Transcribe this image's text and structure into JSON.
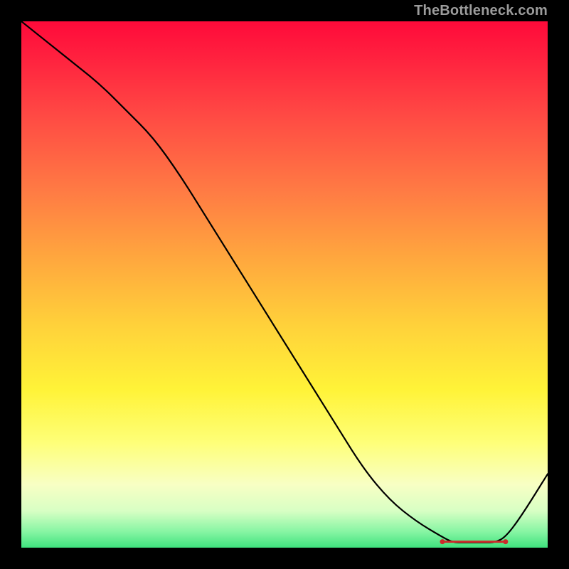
{
  "watermark": "TheBottleneck.com",
  "flat_marker_label": "",
  "chart_data": {
    "type": "line",
    "title": "",
    "xlabel": "",
    "ylabel": "",
    "xlim": [
      0,
      100
    ],
    "ylim": [
      0,
      100
    ],
    "x": [
      0,
      5,
      10,
      15,
      20,
      25,
      30,
      35,
      40,
      45,
      50,
      55,
      60,
      65,
      70,
      75,
      80,
      82,
      84,
      86,
      88,
      90,
      92,
      95,
      100
    ],
    "y": [
      100,
      96,
      92,
      88,
      83,
      78,
      71,
      63,
      55,
      47,
      39,
      31,
      23,
      15,
      9,
      5,
      2,
      1,
      1,
      1,
      1,
      1,
      2,
      6,
      14
    ],
    "annotations": [
      {
        "x": 86,
        "y": 1.5,
        "text": ""
      }
    ],
    "background_gradient_vertical": [
      {
        "pos": 0.0,
        "color": "#ff0a3a"
      },
      {
        "pos": 0.32,
        "color": "#ff7a44"
      },
      {
        "pos": 0.58,
        "color": "#ffd23a"
      },
      {
        "pos": 0.8,
        "color": "#feff78"
      },
      {
        "pos": 0.97,
        "color": "#86f5a3"
      },
      {
        "pos": 1.0,
        "color": "#3fe27e"
      }
    ]
  }
}
